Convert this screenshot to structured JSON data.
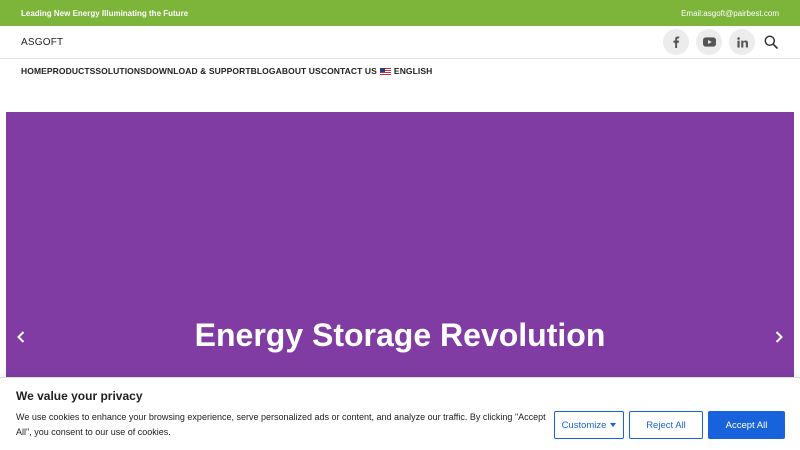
{
  "topbar": {
    "tagline": "Leading New Energy Illuminating the Future",
    "email": "Email:asgoft@pairbest.com"
  },
  "header": {
    "logo": "ASGOFT",
    "social_icons": [
      "facebook-icon",
      "youtube-icon",
      "linkedin-icon"
    ],
    "search_icon": "search-icon"
  },
  "nav": {
    "items": [
      "HOME",
      "PRODUCTS",
      "SOLUTIONS",
      "DOWNLOAD & SUPPORT",
      "BLOG",
      "ABOUT US",
      "CONTACT US"
    ],
    "language": "ENGLISH"
  },
  "hero": {
    "title": "Energy Storage Revolution",
    "background": "#813ca4"
  },
  "cookie": {
    "title": "We value your privacy",
    "text": "We use cookies to enhance your browsing experience, serve personalized ads or content, and analyze our traffic. By clicking \"Accept All\", you consent to our use of cookies.",
    "customize": "Customize",
    "reject": "Reject All",
    "accept": "Accept All"
  },
  "colors": {
    "topbar": "#7cb53a",
    "accent": "#1863dc"
  }
}
